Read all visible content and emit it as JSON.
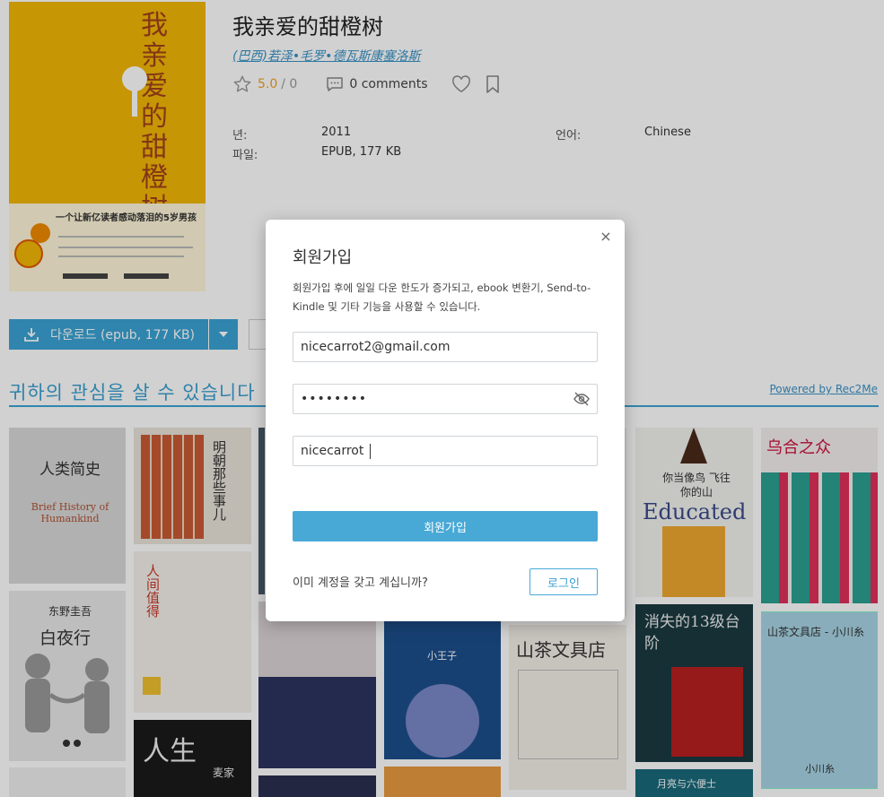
{
  "book": {
    "title": "我亲爱的甜橙树",
    "author": "(巴西)若泽•毛罗•德瓦斯康塞洛斯",
    "rating": "5.0",
    "rating_sep": "/ 0",
    "comments": "0 comments",
    "year_label": "년:",
    "year": "2011",
    "lang_label": "언어:",
    "language": "Chinese",
    "file_label": "파일:",
    "file": "EPUB, 177 KB"
  },
  "cover": {
    "title_chars": "我亲爱的甜橙树",
    "slogan": "一个让新亿读者感动落泪的5岁男孩"
  },
  "actions": {
    "download_label": "다운로드 (epub, 177 KB)"
  },
  "recommend": {
    "title": "귀하의 관심을 살 수 있습니다",
    "powered": "Powered by Rec2Me",
    "tiles": [
      {
        "label": "人类简史"
      },
      {
        "label": "Brief History of Humankind"
      },
      {
        "label": "明朝那些事儿"
      },
      {
        "label": "人间值得"
      },
      {
        "label": "白夜行"
      },
      {
        "label": "东野圭吾"
      },
      {
        "label": "小王子"
      },
      {
        "label": "山茶文具店"
      },
      {
        "label": "你当像鸟 飞往你的山"
      },
      {
        "label": "Educated"
      },
      {
        "label": "乌合之众"
      },
      {
        "label": "消失的13级台阶"
      },
      {
        "label": "山茶文具店 - 小川糸"
      },
      {
        "label": "小川糸"
      },
      {
        "label": "人生"
      },
      {
        "label": "麦家"
      },
      {
        "label": "月亮与六便士"
      }
    ]
  },
  "modal": {
    "title": "회원가입",
    "description": "회원가입 후에 일일 다운 한도가 증가되고, ebook 변환기, Send-to-Kindle 및 기타 기능을 사용할 수 있습니다.",
    "email_value": "nicecarrot2@gmail.com",
    "password_value": "••••••••",
    "name_value": "nicecarrot",
    "submit_label": "회원가입",
    "question": "이미 계정을 갖고 계십니까?",
    "login_label": "로그인",
    "close_glyph": "×"
  },
  "colors": {
    "accent": "#3aa3d4",
    "rating": "#f0a020"
  }
}
